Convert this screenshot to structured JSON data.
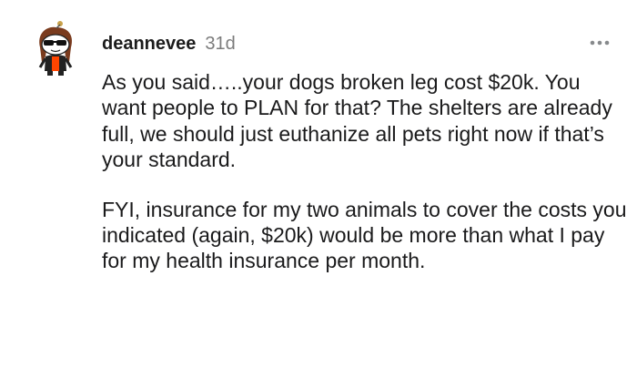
{
  "comment": {
    "author": "deannevee",
    "age": "31d",
    "avatar_icon": "snoo-avatar-icon",
    "more_icon": "more-options-icon",
    "paragraphs": [
      "As you said…..your dogs broken leg cost $20k. You want people to PLAN for that? The shelters are already full, we should just euthanize all pets right now if that’s your standard.",
      "FYI, insurance for my two animals to cover the costs you indicated (again, $20k) would be more than what I pay for my health insurance per month."
    ]
  },
  "colors": {
    "text": "#1a1a1b",
    "muted": "#7c7c7c",
    "accent": "#ff4500"
  }
}
